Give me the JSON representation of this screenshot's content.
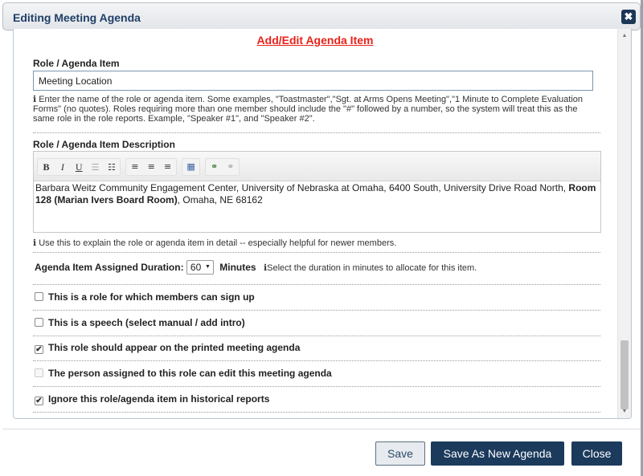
{
  "dialog": {
    "title": "Editing Meeting Agenda",
    "close_glyph": "✖"
  },
  "form": {
    "heading": "Add/Edit Agenda Item",
    "role_label": "Role / Agenda Item",
    "role_value": "Meeting Location",
    "role_help": "Enter the name of the role or agenda item. Some examples, \"Toastmaster\",\"Sgt. at Arms Opens Meeting\",\"1 Minute to Complete Evaluation Forms\" (no quotes). Roles requiring more than one member should include the \"#\" followed by a number, so the system will treat this as the same role in the role reports. Example, \"Speaker #1\", and \"Speaker #2\".",
    "description_label": "Role / Agenda Item Description",
    "description_text_before": "Barbara Weitz Community Engagement Center, University of Nebraska at Omaha, 6400 South, University Drive Road North, ",
    "description_text_bold": "Room 128 (Marian Ivers Board Room)",
    "description_text_after": ", Omaha, NE 68162",
    "description_help": "Use this to explain the role or agenda item in detail -- especially helpful for newer members.",
    "duration_label": "Agenda Item Assigned Duration:",
    "duration_value": "60",
    "duration_unit": "Minutes",
    "duration_help": "Select the duration in minutes to allocate for this item.",
    "checkboxes": [
      {
        "label": "This is a role for which members can sign up",
        "checked": false,
        "disabled": false
      },
      {
        "label": "This is a speech (select manual / add intro)",
        "checked": false,
        "disabled": false
      },
      {
        "label": "This role should appear on the printed meeting agenda",
        "checked": true,
        "disabled": false
      },
      {
        "label": "The person assigned to this role can edit this meeting agenda",
        "checked": false,
        "disabled": true
      },
      {
        "label": "Ignore this role/agenda item in historical reports",
        "checked": true,
        "disabled": false
      }
    ]
  },
  "toolbar": {
    "bold": "B",
    "italic": "I",
    "underline": "U"
  },
  "buttons": {
    "save": "Save",
    "save_as_new": "Save As New Agenda",
    "close": "Close"
  },
  "colors": {
    "heading_red": "#e8221a",
    "primary_navy": "#1b3a5c",
    "title_blue": "#1f3f66"
  }
}
